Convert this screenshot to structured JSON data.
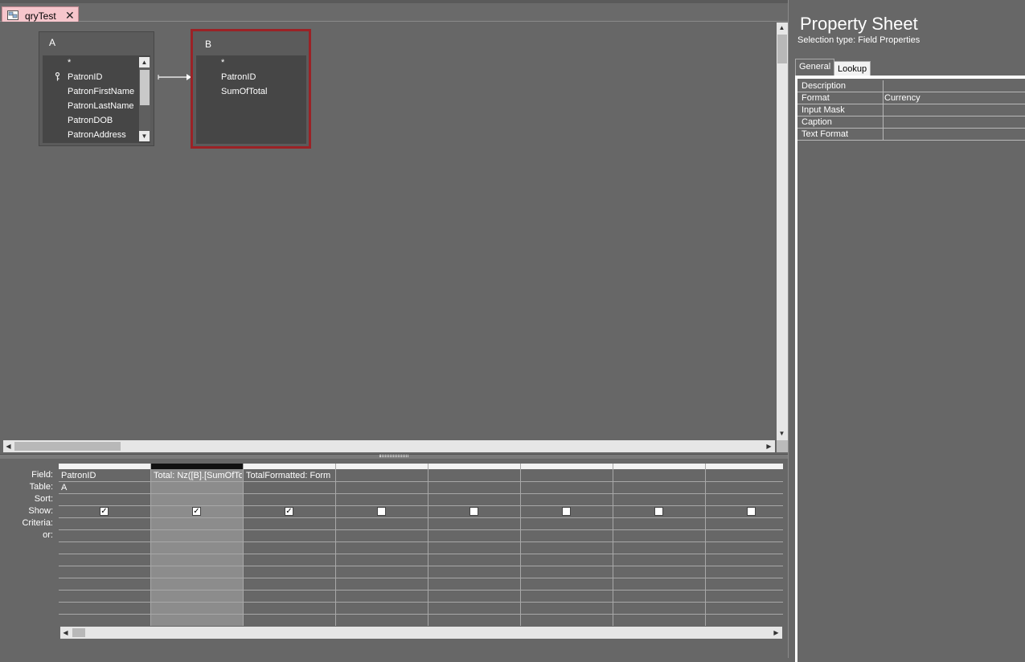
{
  "document_tab": {
    "title": "qryTest",
    "icon": "query-icon",
    "close": "close-icon"
  },
  "design": {
    "tables": [
      {
        "name": "A",
        "fields": [
          "*",
          "PatronID",
          "PatronFirstName",
          "PatronLastName",
          "PatronDOB",
          "PatronAddress"
        ],
        "key_field": "PatronID"
      },
      {
        "name": "B",
        "fields": [
          "*",
          "PatronID",
          "SumOfTotal"
        ]
      }
    ]
  },
  "grid": {
    "row_labels": [
      "Field:",
      "Table:",
      "Sort:",
      "Show:",
      "Criteria:",
      "or:"
    ],
    "columns": [
      {
        "field": "PatronID",
        "table": "A",
        "show": true
      },
      {
        "field": "Total: Nz([B].[SumOfTo",
        "table": "",
        "show": true,
        "selected": true
      },
      {
        "field": "TotalFormatted: Form",
        "table": "",
        "show": true
      },
      {
        "field": "",
        "table": "",
        "show": false
      },
      {
        "field": "",
        "table": "",
        "show": false
      },
      {
        "field": "",
        "table": "",
        "show": false
      },
      {
        "field": "",
        "table": "",
        "show": false
      },
      {
        "field": "",
        "table": "",
        "show": false
      }
    ]
  },
  "property_sheet": {
    "title": "Property Sheet",
    "selection_type": "Selection type:  Field Properties",
    "tabs": [
      "General",
      "Lookup"
    ],
    "rows": [
      {
        "name": "Description",
        "value": ""
      },
      {
        "name": "Format",
        "value": "Currency"
      },
      {
        "name": "Input Mask",
        "value": ""
      },
      {
        "name": "Caption",
        "value": ""
      },
      {
        "name": "Text Format",
        "value": ""
      }
    ]
  },
  "colors": {
    "selected_table_border": "#9b2226",
    "tab_bg": "#f6c6cc",
    "canvas": "#676767"
  }
}
